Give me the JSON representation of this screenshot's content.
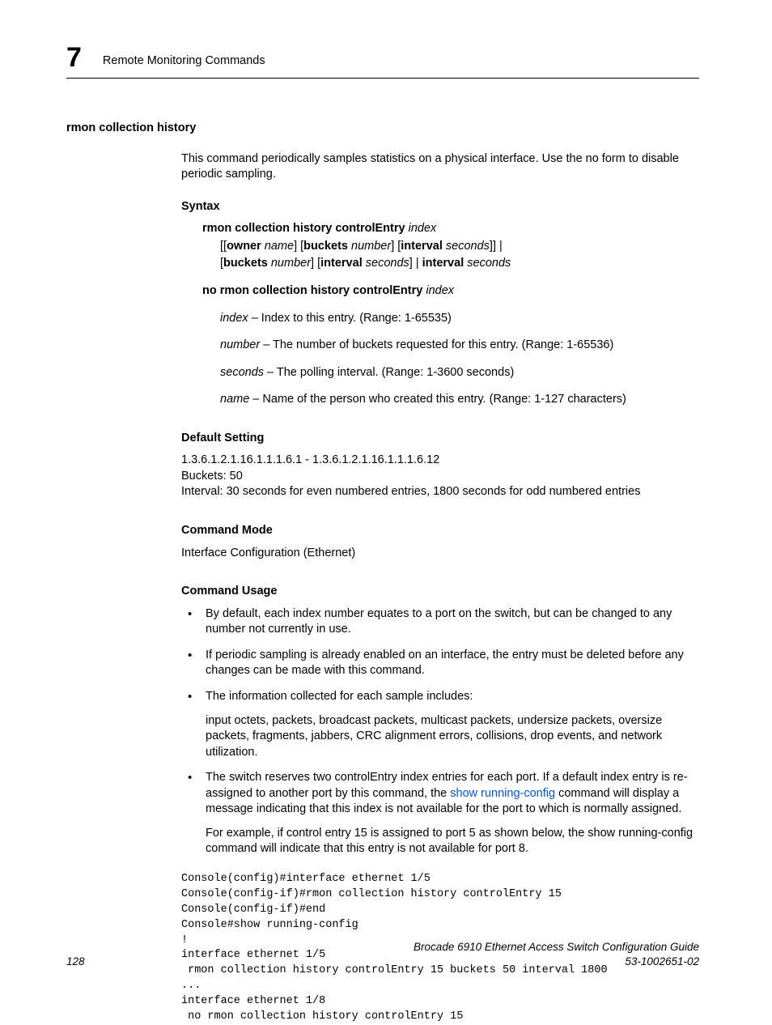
{
  "header": {
    "chapter_number": "7",
    "chapter_title": "Remote Monitoring Commands"
  },
  "section": {
    "title": "rmon collection history",
    "intro": "This command periodically samples statistics on a physical interface. Use the no form to disable periodic sampling."
  },
  "syntax": {
    "heading": "Syntax",
    "cmd_bold_1": "rmon collection history controlEntry",
    "cmd_ital_index": " index",
    "line2_seg1": "[[",
    "line2_owner": "owner",
    "line2_name": " name",
    "line2_seg2": "] [",
    "line2_buckets": "buckets",
    "line2_number": " number",
    "line2_seg3": "] [",
    "line2_interval": "interval",
    "line2_seconds": " seconds",
    "line2_seg4": "]] |",
    "line3_seg1": "[",
    "line3_buckets": "buckets",
    "line3_number": " number",
    "line3_seg2": "] [",
    "line3_interval": "interval",
    "line3_seconds": " seconds",
    "line3_seg3": "] | ",
    "line3_interval2": "interval",
    "line3_seconds2": " seconds",
    "no_cmd_bold": "no rmon collection history controlEntry",
    "no_cmd_ital": " index",
    "params": {
      "index_name": "index",
      "index_desc": " – Index to this entry. (Range: 1-65535)",
      "number_name": "number",
      "number_desc": " – The number of buckets requested for this entry. (Range: 1-65536)",
      "seconds_name": "seconds",
      "seconds_desc": " – The polling interval. (Range: 1-3600 seconds)",
      "name_name": "name",
      "name_desc": " – Name of the person who created this entry. (Range: 1-127 characters)"
    }
  },
  "default_setting": {
    "heading": "Default Setting",
    "line1": "1.3.6.1.2.1.16.1.1.1.6.1 - 1.3.6.1.2.1.16.1.1.1.6.12",
    "line2": "Buckets: 50",
    "line3": "Interval: 30 seconds for even numbered entries, 1800 seconds for odd numbered entries"
  },
  "command_mode": {
    "heading": "Command Mode",
    "text": "Interface Configuration (Ethernet)"
  },
  "command_usage": {
    "heading": "Command Usage",
    "items": [
      {
        "text": "By default, each index number equates to a port on the switch, but can be changed to any number not currently in use."
      },
      {
        "text": "If periodic sampling is already enabled on an interface, the entry must be deleted before any changes can be made with this command."
      },
      {
        "text": "The information collected for each sample includes:",
        "sub": "input octets, packets, broadcast packets, multicast packets, undersize packets, oversize packets, fragments, jabbers, CRC alignment errors, collisions, drop events, and network utilization."
      }
    ],
    "item4_pre": "The switch reserves two controlEntry index entries for each port. If a default index entry is re-assigned to another port by this command, the ",
    "item4_link": "show running-config",
    "item4_post": " command will display a message indicating that this index is not available for the port to which is normally assigned.",
    "item4_sub": "For example, if control entry 15 is assigned to port 5 as shown below, the show running-config command will indicate that this entry is not available for port 8."
  },
  "code_block": "Console(config)#interface ethernet 1/5\nConsole(config-if)#rmon collection history controlEntry 15\nConsole(config-if)#end\nConsole#show running-config\n!\ninterface ethernet 1/5\n rmon collection history controlEntry 15 buckets 50 interval 1800\n...\ninterface ethernet 1/8\n no rmon collection history controlEntry 15",
  "footer": {
    "page_number": "128",
    "doc_title": "Brocade 6910 Ethernet Access Switch Configuration Guide",
    "doc_id": "53-1002651-02"
  }
}
